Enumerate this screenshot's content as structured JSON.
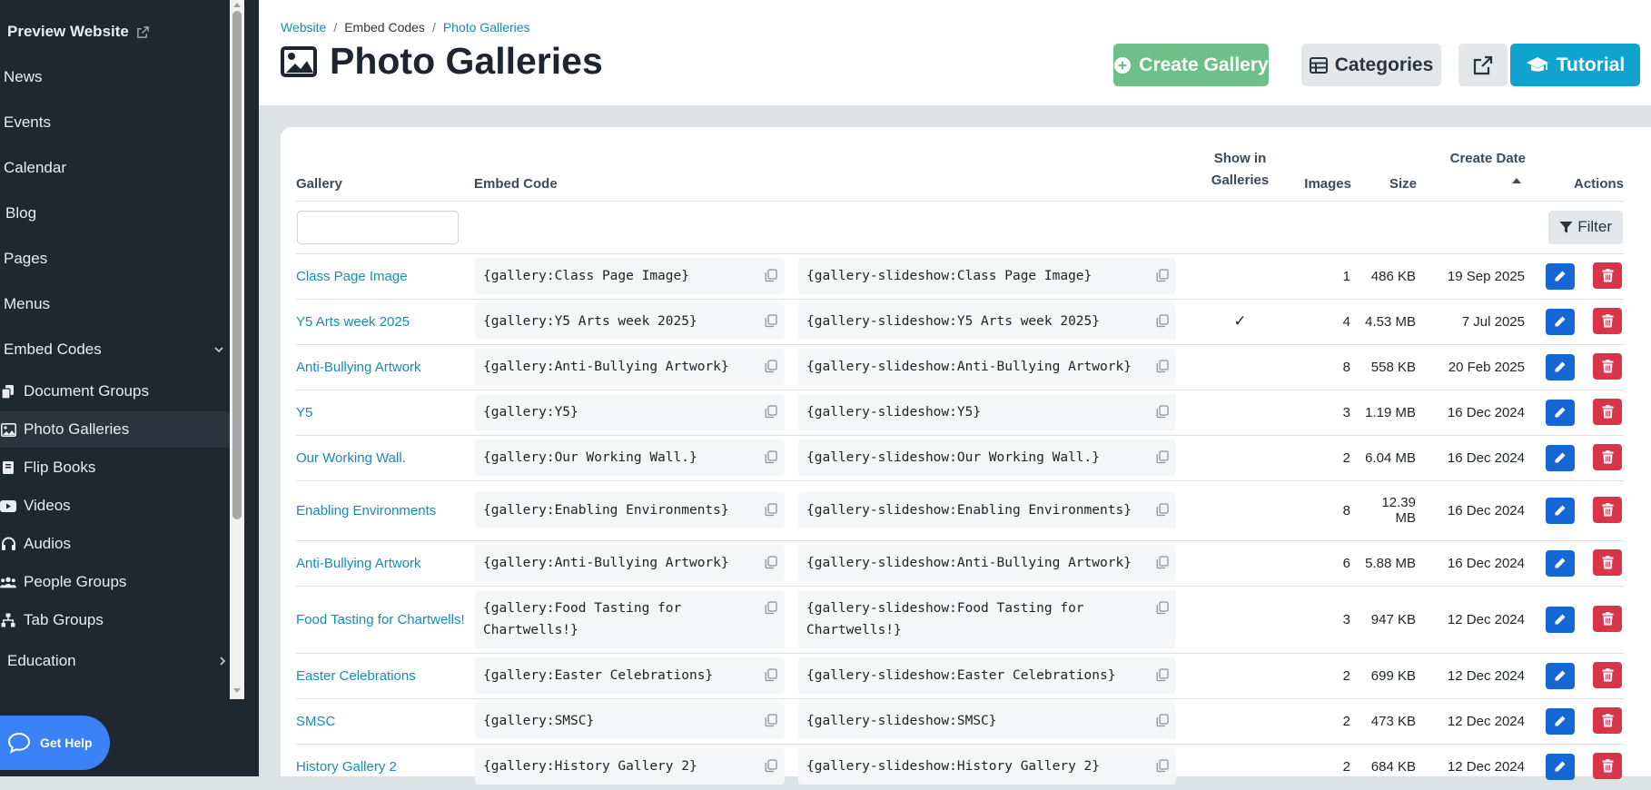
{
  "sidebar": {
    "preview_label": "Preview Website",
    "items": [
      {
        "label": "News"
      },
      {
        "label": "Events"
      },
      {
        "label": "Calendar"
      },
      {
        "label": "Blog"
      },
      {
        "label": "Pages"
      },
      {
        "label": "Menus"
      },
      {
        "label": "Embed Codes"
      }
    ],
    "subitems": [
      {
        "label": "Document Groups",
        "icon": "copy-icon"
      },
      {
        "label": "Photo Galleries",
        "icon": "image-icon"
      },
      {
        "label": "Flip Books",
        "icon": "book-icon"
      },
      {
        "label": "Videos",
        "icon": "youtube-icon"
      },
      {
        "label": "Audios",
        "icon": "headphones-icon"
      },
      {
        "label": "People Groups",
        "icon": "users-icon"
      },
      {
        "label": "Tab Groups",
        "icon": "sitemap-icon"
      }
    ],
    "education_label": "Education",
    "help_label": "Get Help"
  },
  "breadcrumb": {
    "website": "Website",
    "embed_codes": "Embed Codes",
    "current": "Photo Galleries"
  },
  "page_title": "Photo Galleries",
  "toolbar": {
    "create_label": "Create Gallery",
    "categories_label": "Categories",
    "tutorial_label": "Tutorial"
  },
  "table": {
    "headers": {
      "gallery": "Gallery",
      "embed_code": "Embed Code",
      "show_line1": "Show in",
      "show_line2": "Galleries",
      "images": "Images",
      "size": "Size",
      "create_date": "Create Date",
      "actions": "Actions"
    },
    "filter_label": "Filter",
    "rows": [
      {
        "name": "Class Page Image",
        "code": "{gallery:Class Page Image}",
        "slideshow": "{gallery-slideshow:Class Page Image}",
        "show": "",
        "images": "1",
        "size": "486 KB",
        "date": "19 Sep 2025"
      },
      {
        "name": "Y5 Arts week 2025",
        "code": "{gallery:Y5 Arts week 2025}",
        "slideshow": "{gallery-slideshow:Y5 Arts week 2025}",
        "show": "✓",
        "images": "4",
        "size": "4.53 MB",
        "date": "7 Jul 2025"
      },
      {
        "name": "Anti-Bullying Artwork",
        "code": "{gallery:Anti-Bullying Artwork}",
        "slideshow": "{gallery-slideshow:Anti-Bullying Artwork}",
        "show": "",
        "images": "8",
        "size": "558 KB",
        "date": "20 Feb 2025"
      },
      {
        "name": "Y5",
        "code": "{gallery:Y5}",
        "slideshow": "{gallery-slideshow:Y5}",
        "show": "",
        "images": "3",
        "size": "1.19 MB",
        "date": "16 Dec 2024"
      },
      {
        "name": "Our Working Wall.",
        "code": "{gallery:Our Working Wall.}",
        "slideshow": "{gallery-slideshow:Our Working Wall.}",
        "show": "",
        "images": "2",
        "size": "6.04 MB",
        "date": "16 Dec 2024"
      },
      {
        "name": "Enabling Environments",
        "code": "{gallery:Enabling Environments}",
        "slideshow": "{gallery-slideshow:Enabling Environments}",
        "show": "",
        "images": "8",
        "size": "12.39 MB",
        "date": "16 Dec 2024"
      },
      {
        "name": "Anti-Bullying Artwork",
        "code": "{gallery:Anti-Bullying Artwork}",
        "slideshow": "{gallery-slideshow:Anti-Bullying Artwork}",
        "show": "",
        "images": "6",
        "size": "5.88 MB",
        "date": "16 Dec 2024"
      },
      {
        "name": "Food Tasting for Chartwells!",
        "code": "{gallery:Food Tasting for Chartwells!}",
        "slideshow": "{gallery-slideshow:Food Tasting for Chartwells!}",
        "show": "",
        "images": "3",
        "size": "947 KB",
        "date": "12 Dec 2024"
      },
      {
        "name": "Easter Celebrations",
        "code": "{gallery:Easter Celebrations}",
        "slideshow": "{gallery-slideshow:Easter Celebrations}",
        "show": "",
        "images": "2",
        "size": "699 KB",
        "date": "12 Dec 2024"
      },
      {
        "name": "SMSC",
        "code": "{gallery:SMSC}",
        "slideshow": "{gallery-slideshow:SMSC}",
        "show": "",
        "images": "2",
        "size": "473 KB",
        "date": "12 Dec 2024"
      },
      {
        "name": "History Gallery 2",
        "code": "{gallery:History Gallery 2}",
        "slideshow": "{gallery-slideshow:History Gallery 2}",
        "show": "",
        "images": "2",
        "size": "684 KB",
        "date": "12 Dec 2024"
      }
    ]
  },
  "colors": {
    "sidebar_bg": "#1f2730",
    "link": "#1a8bb3",
    "create": "#6fbf8a",
    "tutorial": "#10a3cf",
    "edit": "#1766d6",
    "delete": "#d9344a"
  }
}
